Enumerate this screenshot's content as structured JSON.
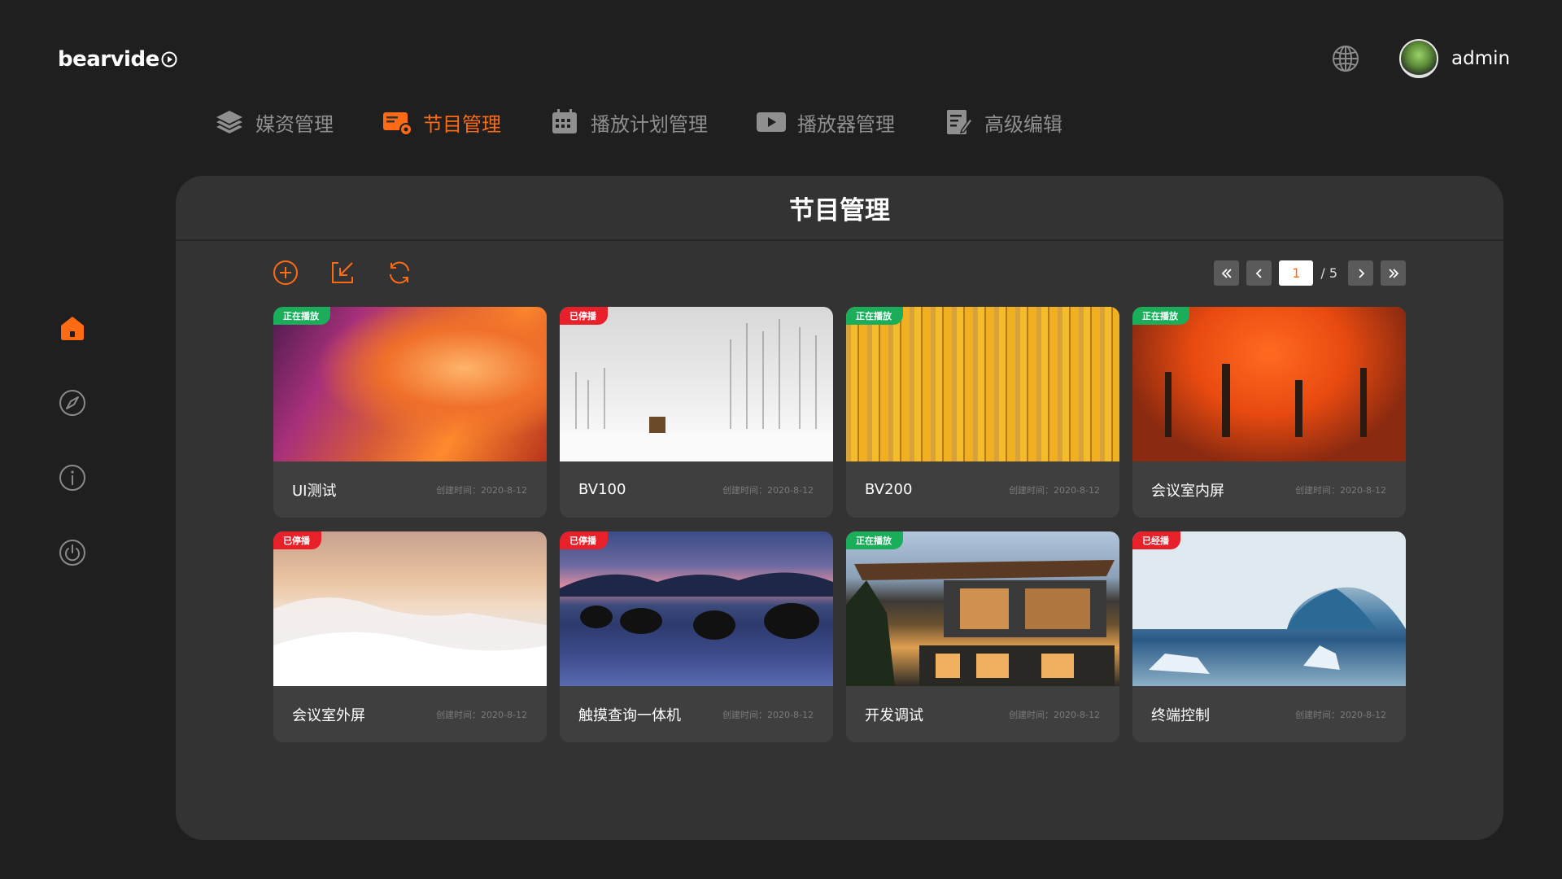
{
  "app": {
    "logo_text": "bearvide",
    "user_name": "admin"
  },
  "nav": {
    "items": [
      {
        "label": "媒资管理",
        "icon": "layers-icon"
      },
      {
        "label": "节目管理",
        "icon": "program-icon",
        "active": true
      },
      {
        "label": "播放计划管理",
        "icon": "calendar-icon"
      },
      {
        "label": "播放器管理",
        "icon": "player-icon"
      },
      {
        "label": "高级编辑",
        "icon": "edit-doc-icon"
      }
    ]
  },
  "sidebar": {
    "items": [
      "home-icon",
      "compass-icon",
      "info-icon",
      "power-icon"
    ]
  },
  "panel": {
    "title": "节目管理"
  },
  "toolbar": {
    "tools": [
      "add-icon",
      "import-icon",
      "refresh-icon"
    ]
  },
  "pager": {
    "current": "1",
    "total_label": "/ 5"
  },
  "programs": [
    {
      "name": "UI测试",
      "status": "正在播放",
      "status_color": "#1aae5a",
      "date": "创建时间：2020-8-12"
    },
    {
      "name": "BV100",
      "status": "已停播",
      "status_color": "#e8202a",
      "date": "创建时间：2020-8-12"
    },
    {
      "name": "BV200",
      "status": "正在播放",
      "status_color": "#1aae5a",
      "date": "创建时间：2020-8-12"
    },
    {
      "name": "会议室内屏",
      "status": "正在播放",
      "status_color": "#1aae5a",
      "date": "创建时间：2020-8-12"
    },
    {
      "name": "会议室外屏",
      "status": "已停播",
      "status_color": "#e8202a",
      "date": "创建时间：2020-8-12"
    },
    {
      "name": "触摸查询一体机",
      "status": "已停播",
      "status_color": "#e8202a",
      "date": "创建时间：2020-8-12"
    },
    {
      "name": "开发调试",
      "status": "正在播放",
      "status_color": "#1aae5a",
      "date": "创建时间：2020-8-12"
    },
    {
      "name": "终端控制",
      "status": "已经播",
      "status_color": "#e8202a",
      "date": "创建时间：2020-8-12"
    }
  ],
  "colors": {
    "accent": "#ff6a14",
    "panel": "#333333",
    "card": "#3f3f3f"
  }
}
